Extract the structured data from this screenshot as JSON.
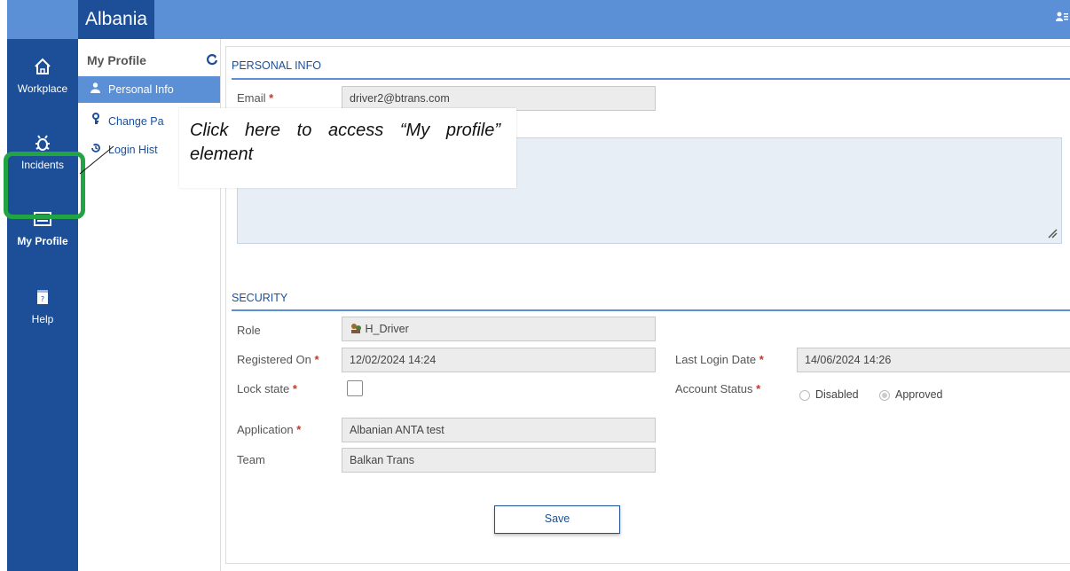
{
  "app": {
    "title": "Albania",
    "user_icon": "user-menu-icon"
  },
  "nav": {
    "items": [
      {
        "label": "Workplace",
        "icon": "home-icon"
      },
      {
        "label": "Incidents",
        "icon": "bug-icon"
      },
      {
        "label": "My Profile",
        "icon": "profile-card-icon"
      },
      {
        "label": "Help",
        "icon": "help-book-icon"
      }
    ]
  },
  "profile_panel": {
    "title": "My Profile",
    "items": [
      {
        "label": "Personal Info",
        "icon": "person-icon"
      },
      {
        "label": "Change Pa",
        "icon": "key-icon"
      },
      {
        "label": "Login Hist",
        "icon": "history-icon"
      }
    ]
  },
  "personal_info": {
    "section_title": "PERSONAL INFO",
    "email_label": "Email",
    "email_value": "driver2@btrans.com"
  },
  "security": {
    "section_title": "SECURITY",
    "role_label": "Role",
    "role_value": "H_Driver",
    "registered_label": "Registered On",
    "registered_value": "12/02/2024 14:24",
    "last_login_label": "Last Login Date",
    "last_login_value": "14/06/2024 14:26",
    "lock_label": "Lock state",
    "lock_checked": false,
    "account_status_label": "Account Status",
    "status_options": [
      "Disabled",
      "Approved"
    ],
    "status_selected": "Approved",
    "application_label": "Application",
    "application_value": "Albanian ANTA test",
    "team_label": "Team",
    "team_value": "Balkan Trans"
  },
  "required_mark": "*",
  "save_label": "Save",
  "callout": {
    "text": "Click here to access “My profile” element"
  },
  "colors": {
    "nav_bg": "#1c4f98",
    "topbar_bg": "#5b8fd6",
    "highlight": "#22a445"
  }
}
